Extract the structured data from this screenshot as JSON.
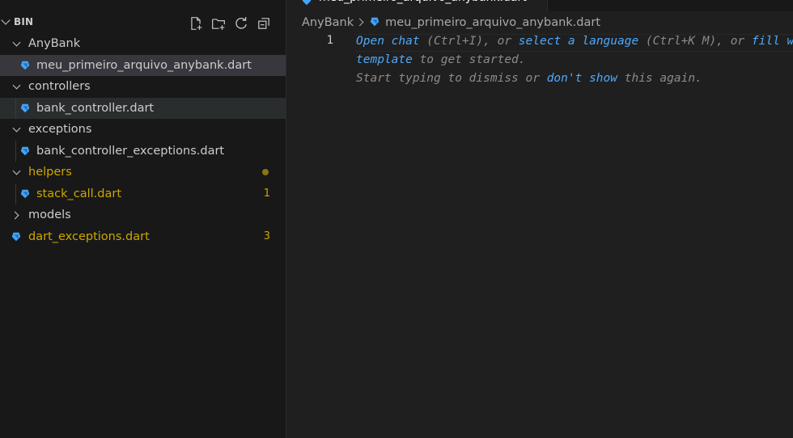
{
  "explorer": {
    "title": "BIN",
    "actions": [
      {
        "name": "new-file-icon"
      },
      {
        "name": "new-folder-icon"
      },
      {
        "name": "refresh-icon"
      },
      {
        "name": "collapse-all-icon"
      }
    ],
    "tree": [
      {
        "label": "AnyBank",
        "type": "folder",
        "expanded": true
      },
      {
        "label": "meu_primeiro_arquivo_anybank.dart",
        "type": "file",
        "selected": true
      },
      {
        "label": "controllers",
        "type": "folder",
        "expanded": true
      },
      {
        "label": "bank_controller.dart",
        "type": "file"
      },
      {
        "label": "exceptions",
        "type": "folder",
        "expanded": true
      },
      {
        "label": "bank_controller_exceptions.dart",
        "type": "file"
      },
      {
        "label": "helpers",
        "type": "folder",
        "expanded": true,
        "status": "warning"
      },
      {
        "label": "stack_call.dart",
        "type": "file",
        "status": "warning",
        "badge": "1"
      },
      {
        "label": "models",
        "type": "folder",
        "expanded": false
      },
      {
        "label": "dart_exceptions.dart",
        "type": "file",
        "status": "warning",
        "badge": "3"
      }
    ]
  },
  "editor": {
    "breadcrumb": {
      "folder": "AnyBank",
      "file": "meu_primeiro_arquivo_anybank.dart"
    },
    "line_number": "1",
    "hint": {
      "open_chat": "Open chat",
      "shortcut1": " (Ctrl+I), or ",
      "select_language": "select a language",
      "shortcut2": " (Ctrl+K M), or ",
      "fill_with": "fill with",
      "template": "template",
      "to_get_started": " to get started.",
      "start_typing": "Start typing to dismiss or ",
      "dont_show": "don't show",
      "this_again": " this again."
    }
  },
  "colors": {
    "sidebar_bg": "#181818",
    "editor_bg": "#1f1f1f",
    "selection": "#37373d",
    "warning": "#cca700",
    "link": "#4daafc",
    "dart_icon": "#42a5f5"
  }
}
